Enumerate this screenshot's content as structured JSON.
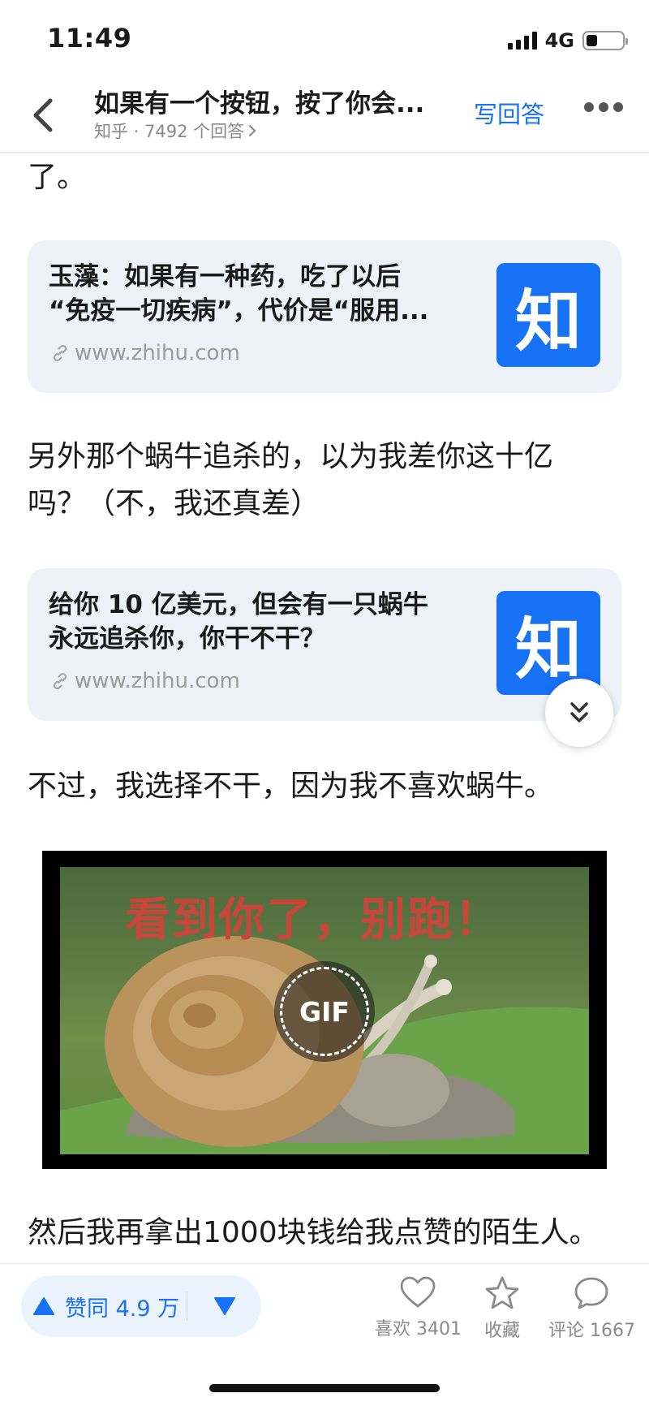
{
  "status_bar": {
    "time": "11:49",
    "network": "4G",
    "battery_level": 0.3
  },
  "header": {
    "title": "如果有一个按钮，按了你会...",
    "subtitle": "知乎 · 7492 个回答",
    "write_answer_label": "写回答"
  },
  "content": {
    "para_0": "了。",
    "card_1": {
      "line_1": "玉藻：如果有一种药，吃了以后",
      "line_2": "“免疫一切疾病”，代价是“服用...",
      "link": "www.zhihu.com",
      "logo_char": "知"
    },
    "para_1_line_1": "另外那个蜗牛追杀的，以为我差你这十亿",
    "para_1_line_2": "吗？（不，我还真差）",
    "card_2": {
      "line_1": "给你 10 亿美元，但会有一只蜗牛",
      "line_2": "永远追杀你，你干不干？",
      "link": "www.zhihu.com",
      "logo_char": "知"
    },
    "para_2": "不过，我选择不干，因为我不喜欢蜗牛。",
    "gif": {
      "caption": "看到你了，别跑！",
      "badge": "GIF"
    },
    "para_3": "然后我再拿出1000块钱给我点赞的陌生人。"
  },
  "bottom_bar": {
    "upvote_label": "赞同 4.9 万",
    "like_label": "喜欢 3401",
    "collect_label": "收藏",
    "comment_label": "评论 1667"
  },
  "colors": {
    "accent": "#1772f6",
    "card_bg": "#eef1f7",
    "text": "#1a1a1a",
    "muted": "#8a8a8a"
  },
  "icons": [
    "back-chevron-icon",
    "more-dots-icon",
    "link-icon",
    "zhihu-logo-icon",
    "double-chevron-down-icon",
    "upvote-triangle-icon",
    "downvote-triangle-icon",
    "heart-icon",
    "star-icon",
    "comment-bubble-icon"
  ]
}
